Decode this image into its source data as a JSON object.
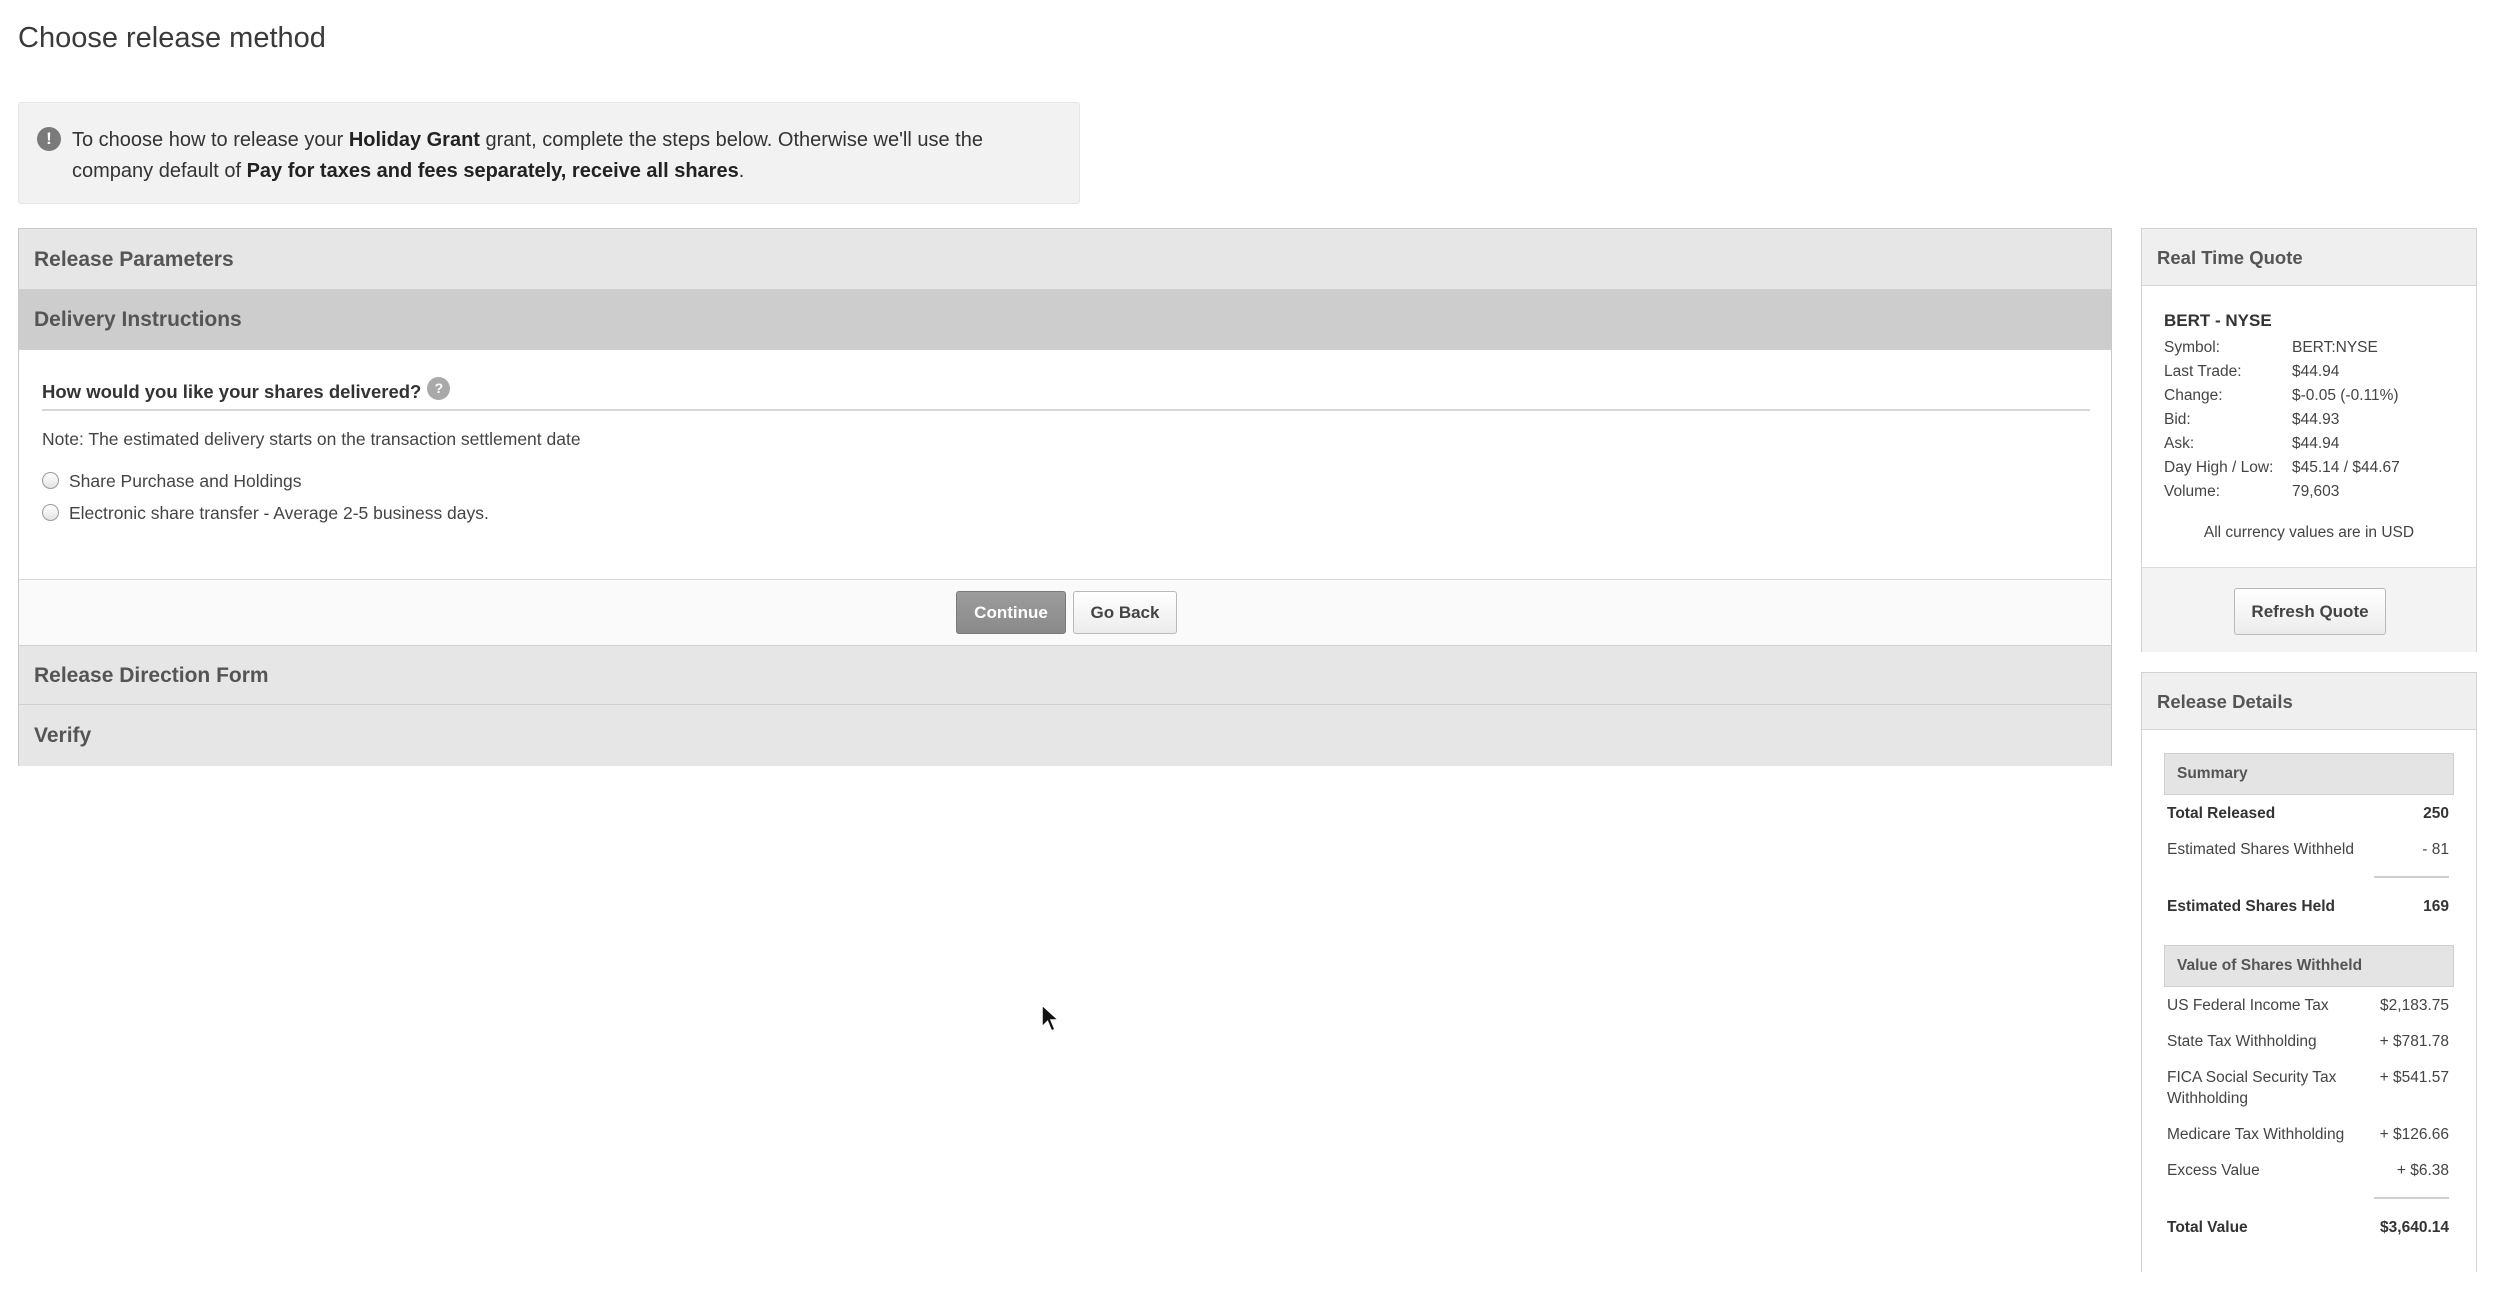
{
  "page_title": "Choose release method",
  "notice": {
    "icon": "exclamation-icon",
    "part1": "To choose how to release your ",
    "grant_name": "Holiday Grant",
    "part2": " grant, complete the steps below. Otherwise we'll use the company default of ",
    "default_method": "Pay for taxes and fees separately, receive all shares",
    "part3": "."
  },
  "wizard": {
    "steps": [
      {
        "label": "Release Parameters"
      },
      {
        "label": "Delivery Instructions"
      },
      {
        "label": "Release Direction Form"
      },
      {
        "label": "Verify"
      }
    ],
    "active_step": 1,
    "question": "How would you like your shares delivered?",
    "help_icon": "?",
    "note": "Note: The estimated delivery starts on the transaction settlement date",
    "options": [
      {
        "label": "Share Purchase and Holdings",
        "selected": false
      },
      {
        "label": "Electronic share transfer - Average 2-5 business days.",
        "selected": false
      }
    ],
    "continue_label": "Continue",
    "back_label": "Go Back"
  },
  "quote": {
    "title": "Real Time Quote",
    "symbol_head": "BERT - NYSE",
    "rows": [
      {
        "label": "Symbol:",
        "value": "BERT:NYSE"
      },
      {
        "label": "Last Trade:",
        "value": "$44.94"
      },
      {
        "label": "Change:",
        "value": "$-0.05 (-0.11%)"
      },
      {
        "label": "Bid:",
        "value": "$44.93"
      },
      {
        "label": "Ask:",
        "value": "$44.94"
      },
      {
        "label": "Day High / Low:",
        "value": "$45.14 / $44.67"
      },
      {
        "label": "Volume:",
        "value": "79,603"
      }
    ],
    "currency_note": "All currency values are in USD",
    "refresh_label": "Refresh Quote"
  },
  "details": {
    "title": "Release Details",
    "summary_head": "Summary",
    "total_released_label": "Total Released",
    "total_released": "250",
    "withheld_label": "Estimated Shares Withheld",
    "withheld": "- 81",
    "held_label": "Estimated Shares Held",
    "held": "169",
    "value_head": "Value of Shares Withheld",
    "value_rows": [
      {
        "label": "US Federal Income Tax",
        "value": "$2,183.75"
      },
      {
        "label": "State Tax Withholding",
        "value": "+ $781.78"
      },
      {
        "label": "FICA Social Security Tax Withholding",
        "value": "+ $541.57"
      },
      {
        "label": "Medicare Tax Withholding",
        "value": "+ $126.66"
      },
      {
        "label": "Excess Value",
        "value": "+ $6.38"
      }
    ],
    "total_value_label": "Total Value",
    "total_value": "$3,640.14"
  }
}
